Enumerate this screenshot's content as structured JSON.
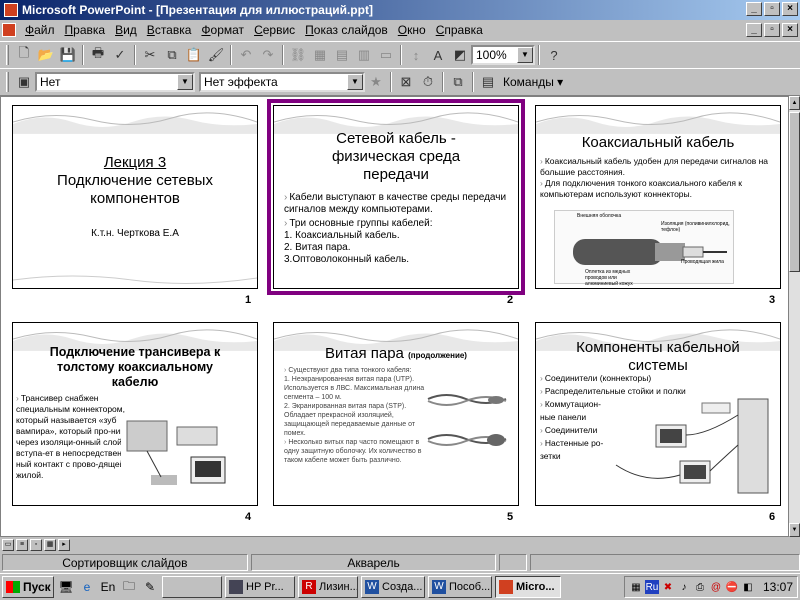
{
  "window": {
    "title": "Microsoft PowerPoint - [Презентация для иллюстраций.ppt]"
  },
  "menu": {
    "items": [
      "Файл",
      "Правка",
      "Вид",
      "Вставка",
      "Формат",
      "Сервис",
      "Показ слайдов",
      "Окно",
      "Справка"
    ]
  },
  "toolbar1": {
    "zoom": "100%"
  },
  "toolbar2": {
    "transition": "Нет",
    "effect": "Нет эффекта",
    "commands": "Команды"
  },
  "slides": [
    {
      "num": "1",
      "title1": "Лекция 3",
      "title2": "Подключение сетевых компонентов",
      "author": "К.т.н. Черткова Е.А"
    },
    {
      "num": "2",
      "title": "Сетевой кабель - физическая среда передачи",
      "b1": "Кабели выступают в качестве среды передачи сигналов между компьютерами.",
      "b2": "Три основные группы кабелей:",
      "l1": "1. Коаксиальный кабель.",
      "l2": "2. Витая пара.",
      "l3": "3.Оптоволоконный кабель."
    },
    {
      "num": "3",
      "title": "Коаксиальный кабель",
      "b1": "Коаксиальный кабель удобен для передачи сигналов на большие расстояния.",
      "b2": "Для подключения тонкого коаксиального кабеля к компьютерам используют коннекторы.",
      "lbl1": "Внешняя оболочка",
      "lbl2": "Изоляция (поливинилхлорид, тефлон)",
      "lbl3": "Оплетка из медных проводов или алюминиевый кожух",
      "lbl4": "Проводящая жила"
    },
    {
      "num": "4",
      "title": "Подключение трансивера к толстому коаксиальному кабелю",
      "body": "Трансивер снабжен специальным коннектором, который называется «зуб вампира», который про-никает через изоляци-онный слой и вступа-ет в непосредствен-ный  контакт с прово-дящей жилой."
    },
    {
      "num": "5",
      "title": "Витая пара",
      "title_note": "(продолжение)",
      "p1": "Существуют два типа тонкого кабеля:",
      "p2": "1. Неэкранированная витая пара (UTP). Используется в ЛВС. Максимальная длина сегмента – 100 м.",
      "p3": "2. Экранированная витая пара (STP). Обладает прекрасной изоляцией, защищающей передаваемые данные от помех.",
      "p4": "Несколько витых пар часто помещают в одну защитную оболочку. Их количество в таком кабеле может быть различно."
    },
    {
      "num": "6",
      "title": "Компоненты кабельной системы",
      "items": [
        "Соединители (коннекторы)",
        "Распределительные стойки и полки",
        "Коммутацион-",
        "ные панели",
        "Соединители",
        "Настенные ро-",
        "зетки"
      ]
    }
  ],
  "status": {
    "view": "Сортировщик слайдов",
    "design": "Акварель"
  },
  "taskbar": {
    "start": "Пуск",
    "tasks": [
      "HP Pr...",
      "Лизин...",
      "Созда...",
      "Пособ...",
      "Micro..."
    ],
    "clock": "13:07"
  }
}
